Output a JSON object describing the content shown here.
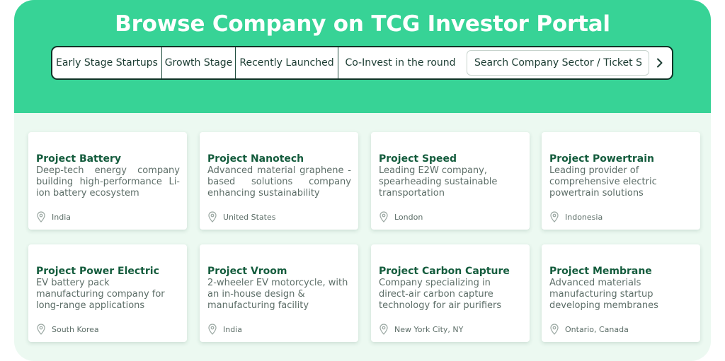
{
  "header": {
    "title": "Browse Company on TCG Investor Portal"
  },
  "tabs": [
    {
      "label": "Early Stage Startups"
    },
    {
      "label": "Growth Stage"
    },
    {
      "label": "Recently Launched"
    },
    {
      "label": "Co-Invest in the round"
    }
  ],
  "search": {
    "placeholder": "Search Company Sector / Ticket Size"
  },
  "icons": {
    "next": "chevron-right-icon",
    "location": "location-pin-icon"
  },
  "colors": {
    "brand_green": "#37d396",
    "title_green": "#145c3d",
    "panel_bg": "#ecf9f1"
  },
  "companies": [
    {
      "name": "Project Battery",
      "description": "Deep-tech energy company building high-performance Li-ion battery ecosystem",
      "location": "India"
    },
    {
      "name": "Project Nanotech",
      "description": "Advanced material graphene -based solutions company enhancing sustainability",
      "location": "United States"
    },
    {
      "name": "Project Speed",
      "description": "Leading E2W company, spearheading sustainable transportation",
      "location": "London"
    },
    {
      "name": "Project Powertrain",
      "description": "Leading provider of comprehensive electric powertrain solutions",
      "location": "Indonesia"
    },
    {
      "name": "Project Power Electric",
      "description": "EV battery pack manufacturing company for long-range applications",
      "location": "South Korea"
    },
    {
      "name": "Project Vroom",
      "description": "2-wheeler EV motorcycle, with an in-house design & manufacturing facility",
      "location": "India"
    },
    {
      "name": "Project Carbon Capture",
      "description": "Company specializing in direct-air carbon capture technology for air purifiers",
      "location": "New York City, NY"
    },
    {
      "name": "Project Membrane",
      "description": "Advanced materials manufacturing startup developing membranes",
      "location": "Ontario, Canada"
    }
  ]
}
